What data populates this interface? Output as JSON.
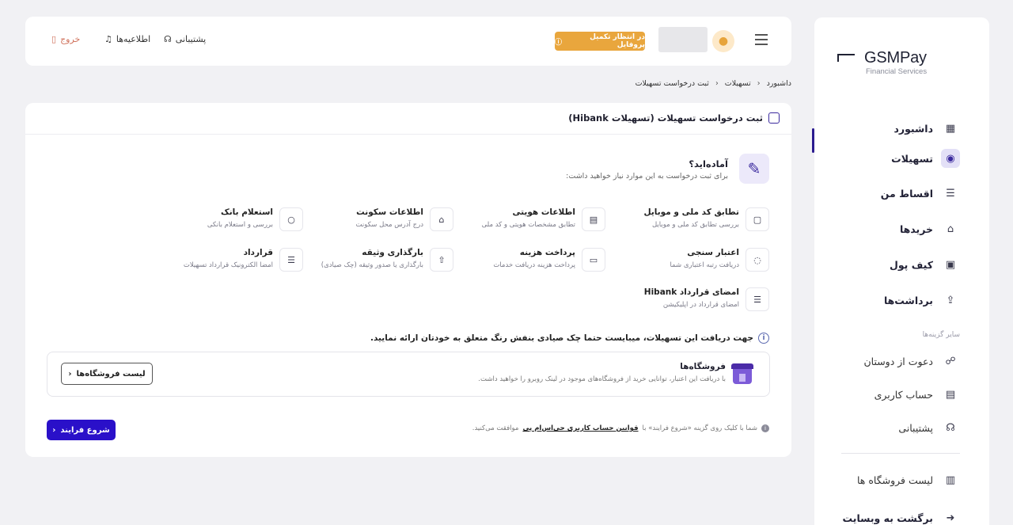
{
  "brand": {
    "name": "GSMPay",
    "subtitle": "Financial Services"
  },
  "sidebar": {
    "items": [
      {
        "label": "داشبورد",
        "icon": "dashboard-icon",
        "glyph": "▦"
      },
      {
        "label": "تسهیلات",
        "icon": "coins-icon",
        "glyph": "◉",
        "active": true
      },
      {
        "label": "اقساط من",
        "icon": "document-icon",
        "glyph": "☰"
      },
      {
        "label": "خریدها",
        "icon": "bag-icon",
        "glyph": "⌂"
      },
      {
        "label": "کیف پول",
        "icon": "wallet-icon",
        "glyph": "▣"
      },
      {
        "label": "برداشت‌ها",
        "icon": "upload-icon",
        "glyph": "⇪"
      }
    ],
    "section_label": "سایر گزینه‌ها",
    "other_items": [
      {
        "label": "دعوت از دوستان",
        "icon": "invite-icon",
        "glyph": "☍"
      },
      {
        "label": "حساب کاربری",
        "icon": "id-card-icon",
        "glyph": "▤"
      },
      {
        "label": "پشتیبانی",
        "icon": "headset-icon",
        "glyph": "☊"
      }
    ],
    "bottom_items": [
      {
        "label": "لیست فروشگاه ها",
        "icon": "store-icon",
        "glyph": "▥"
      },
      {
        "label": "برگشت به وبسایت",
        "icon": "arrow-circle-icon",
        "glyph": "➜"
      }
    ]
  },
  "header": {
    "pending_profile": "در انتظار تکمیل پروفایل",
    "support": "پشتیبانی",
    "notifications": "اطلاعیه‌ها",
    "logout": "خروج"
  },
  "breadcrumb": [
    "داشبورد",
    "تسهیلات",
    "ثبت درخواست تسهیلات"
  ],
  "card": {
    "title": "ثبت درخواست تسهیلات (تسهیلات Hibank)",
    "ready_title": "آماده‌اید؟",
    "ready_desc": "برای ثبت درخواست به این موارد نیاز خواهید داشت:",
    "requirements": [
      {
        "title": "تطابق کد ملی و موبایل",
        "desc": "بررسی تطابق کد ملی و موبایل",
        "icon": "sim-icon",
        "glyph": "▢"
      },
      {
        "title": "اطلاعات هویتی",
        "desc": "تطابق مشخصات هویتی و کد ملی",
        "icon": "id-card-icon",
        "glyph": "▤"
      },
      {
        "title": "اطلاعات سکونت",
        "desc": "درج آدرس محل سکونت",
        "icon": "home-icon",
        "glyph": "⌂"
      },
      {
        "title": "استعلام بانک",
        "desc": "بررسی و استعلام بانکی",
        "icon": "search-icon",
        "glyph": "○"
      },
      {
        "title": "اعتبار سنجی",
        "desc": "دریافت رتبه اعتباری شما",
        "icon": "gauge-icon",
        "glyph": "◌"
      },
      {
        "title": "پرداخت هزینه",
        "desc": "پرداخت هزینه دریافت خدمات",
        "icon": "cash-icon",
        "glyph": "▭"
      },
      {
        "title": "بارگذاری وثیقه",
        "desc": "بارگذاری یا صدور وثیقه (چک صیادی)",
        "icon": "upload-doc-icon",
        "glyph": "⇧"
      },
      {
        "title": "قرارداد",
        "desc": "امضا الکترونیک قرارداد تسهیلات",
        "icon": "contract-icon",
        "glyph": "☰"
      },
      {
        "title": "امضای قرارداد Hibank",
        "desc": "امضای قرارداد در اپلیکیشن",
        "icon": "sign-icon",
        "glyph": "☰"
      }
    ],
    "note": "جهت دریافت این تسهیلات، میبایست حتما چک صیادی بنفش رنگ متعلق به خودتان ارائه نمایید.",
    "shops_title": "فروشگاه‌ها",
    "shops_desc": "با دریافت این اعتبار، توانایی خرید از فروشگاه‌های موجود در لینک روبرو را خواهید داشت.",
    "shops_button": "لیست فروشگاه‌ها",
    "terms_prefix": "شما با کلیک روی گزینه «شروع فرایند» با",
    "terms_link": "قوانین حساب کاربری جی‌اس‌ام پی",
    "terms_suffix": "موافقت می‌کنید.",
    "start_button": "شروع فرایند"
  }
}
